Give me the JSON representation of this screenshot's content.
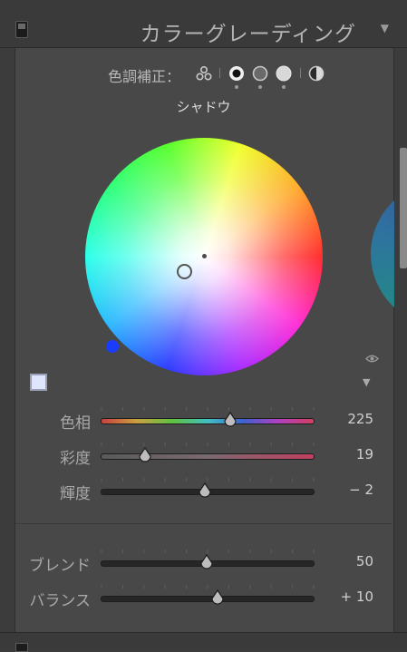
{
  "header": {
    "title": "カラーグレーディング"
  },
  "tones": {
    "label": "色調補正：",
    "selected": "shadow",
    "buttons": [
      "3-way",
      "shadow",
      "midtone",
      "highlight",
      "global"
    ]
  },
  "wheel": {
    "section_label": "シャドウ",
    "hue": 225,
    "saturation": 19,
    "swatch_color": "#dfe4ff"
  },
  "sliders": [
    {
      "label": "色相",
      "value": "225",
      "position": 0.61,
      "track": "hue"
    },
    {
      "label": "彩度",
      "value": "19",
      "position": 0.21,
      "track": "sat"
    },
    {
      "label": "輝度",
      "value": "− 2",
      "position": 0.49,
      "track": "plain"
    }
  ],
  "global_sliders": [
    {
      "label": "ブレンド",
      "value": "50",
      "position": 0.5
    },
    {
      "label": "バランス",
      "value": "+ 10",
      "position": 0.55
    }
  ],
  "colors": {
    "panel": "#484848",
    "header": "#3a3a3a",
    "accent_knob": "#1a3cff"
  }
}
